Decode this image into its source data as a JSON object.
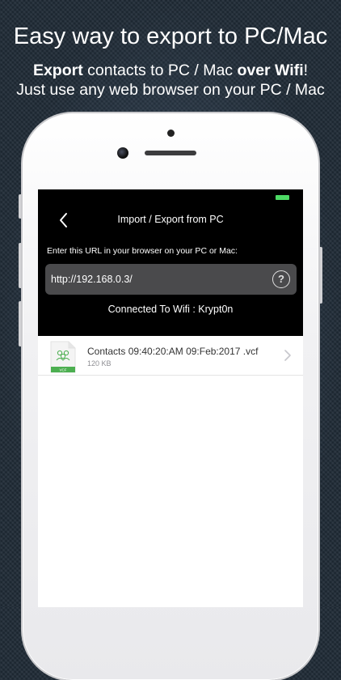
{
  "promo": {
    "headline": "Easy way to export to PC/Mac",
    "line1_bold_a": "Export",
    "line1_mid": " contacts to PC / Mac ",
    "line1_bold_b": "over Wifi",
    "line1_end": "!",
    "line2": "Just use any web browser on your PC / Mac"
  },
  "screen": {
    "nav_title": "Import / Export from PC",
    "instruction": "Enter this URL in your browser on your PC or Mac:",
    "url": "http://192.168.0.3/",
    "help_label": "?",
    "wifi_status": "Connected To Wifi : Krypt0n",
    "files": [
      {
        "name": "Contacts 09:40:20:AM 09:Feb:2017 .vcf",
        "size": "120 KB",
        "icon_badge": "VCF"
      }
    ]
  },
  "colors": {
    "battery": "#4cd964",
    "file_icon_accent": "#4caf50",
    "screen_header": "#000000",
    "url_field": "#4a4a4c"
  },
  "icons": [
    "back-chevron-icon",
    "help-icon",
    "vcf-file-icon",
    "chevron-right-icon",
    "battery-icon"
  ]
}
